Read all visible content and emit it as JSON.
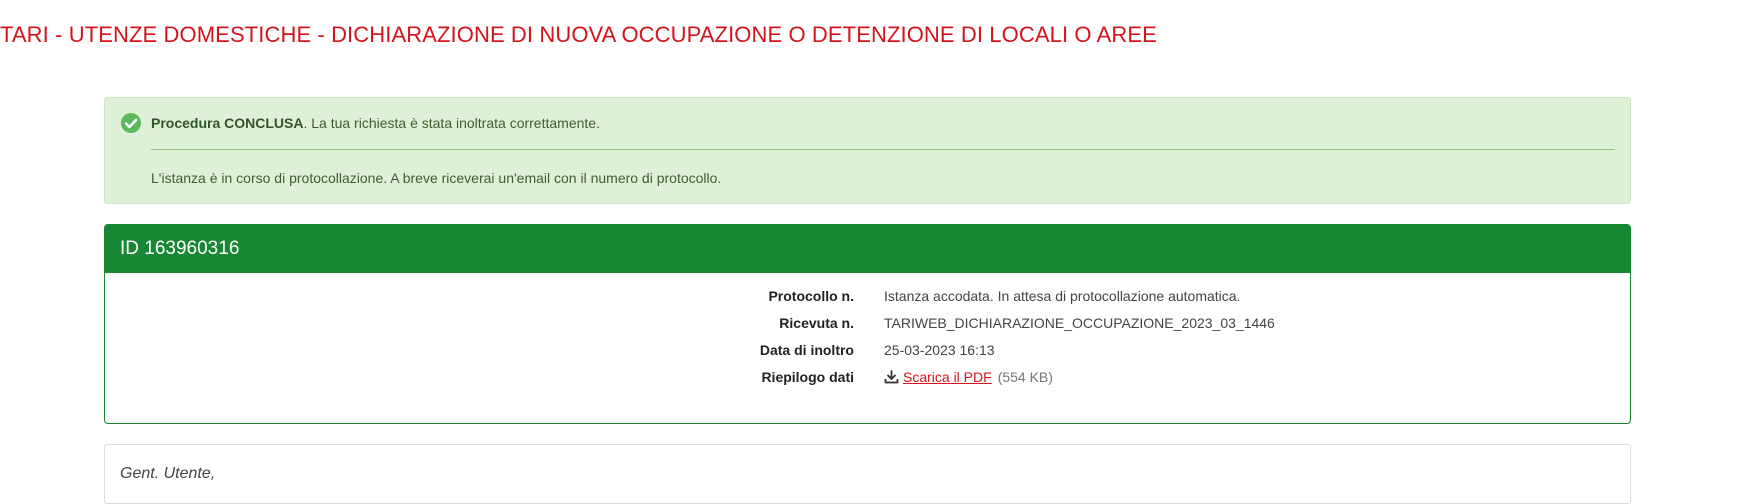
{
  "page": {
    "title": "TARI - UTENZE DOMESTICHE - DICHIARAZIONE DI NUOVA OCCUPAZIONE O DETENZIONE DI LOCALI O AREE"
  },
  "alert": {
    "icon": "check-circle-icon",
    "status_bold": "Procedura CONCLUSA",
    "status_rest": ". La tua richiesta è stata inoltrata correttamente.",
    "message": "L'istanza è in corso di protocollazione. A breve riceverai un'email con il numero di protocollo."
  },
  "card": {
    "header": "ID 163960316",
    "rows": [
      {
        "label": "Protocollo n.",
        "value": "Istanza accodata. In attesa di protocollazione automatica."
      },
      {
        "label": "Ricevuta n.",
        "value": "TARIWEB_DICHIARAZIONE_OCCUPAZIONE_2023_03_1446"
      },
      {
        "label": "Data di inoltro",
        "value": "25-03-2023 16:13"
      },
      {
        "label": "Riepilogo dati",
        "link_label": "Scarica il PDF",
        "size": "(554 KB)",
        "icon": "download-icon"
      }
    ]
  },
  "letter": {
    "greeting": "Gent. Utente,"
  },
  "colors": {
    "title_red": "#d4141c",
    "success_green": "#178733",
    "alert_bg": "#dff0d8"
  }
}
